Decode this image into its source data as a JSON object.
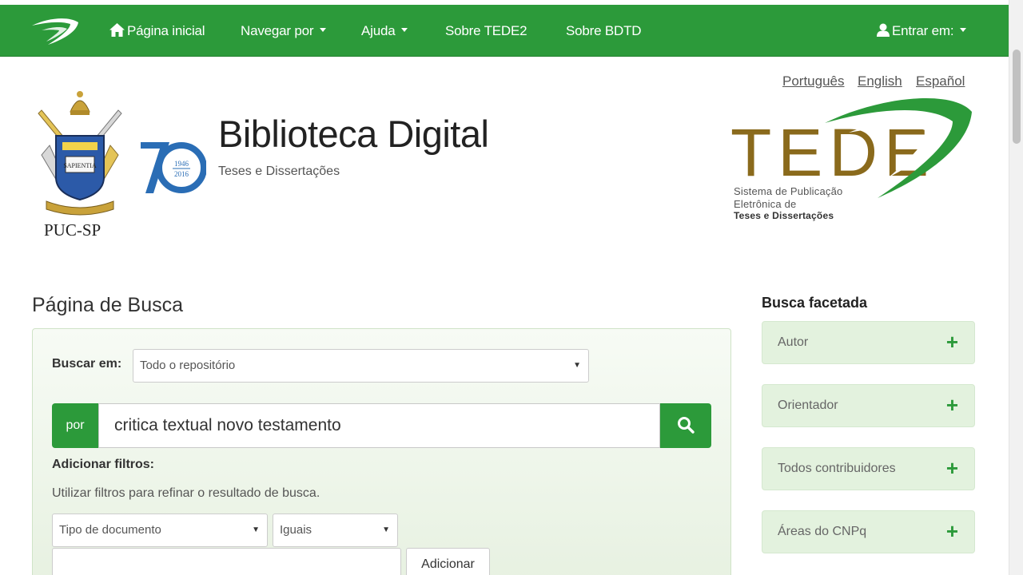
{
  "nav": {
    "home": "Página inicial",
    "browse": "Navegar por",
    "help": "Ajuda",
    "about_tede2": "Sobre TEDE2",
    "about_bdtd": "Sobre BDTD",
    "login": "Entrar em:"
  },
  "languages": [
    "Português",
    "English",
    "Español"
  ],
  "header": {
    "title": "Biblioteca Digital",
    "subtitle": "Teses e Dissertações",
    "institution": "PUC-SP",
    "anniversary_years": [
      "1946",
      "2016"
    ],
    "crest_motto": "SAPIENTIA",
    "tede_logo_text": "TEDE",
    "tede_sub": [
      "Sistema de Publicação",
      "Eletrônica de",
      "Teses e Dissertações"
    ]
  },
  "search": {
    "heading": "Página de Busca",
    "scope_label": "Buscar em:",
    "scope_value": "Todo o repositório",
    "por_label": "por",
    "query": "critica textual novo testamento",
    "filters_label": "Adicionar filtros:",
    "filters_help": "Utilizar filtros para refinar o resultado de busca.",
    "filter_field": "Tipo de documento",
    "filter_op": "Iguais",
    "filter_value": "",
    "add_button": "Adicionar"
  },
  "facets": {
    "title": "Busca facetada",
    "items": [
      "Autor",
      "Orientador",
      "Todos contribuidores",
      "Áreas do CNPq"
    ]
  },
  "colors": {
    "brand_green": "#2c9a3a",
    "facet_bg": "#e3f2de",
    "tede_brown": "#8a6a1c"
  }
}
